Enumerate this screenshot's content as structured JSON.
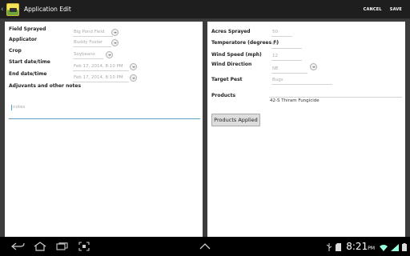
{
  "actionbar": {
    "title": "Application Edit",
    "cancel_label": "CANCEL",
    "save_label": "SAVE"
  },
  "left_panel": {
    "field_sprayed": {
      "label": "Field Sprayed",
      "value": "Big Pond Field"
    },
    "applicator": {
      "label": "Applicator",
      "value": "Buddy Foster"
    },
    "crop": {
      "label": "Crop",
      "value": "Soybeans"
    },
    "start_datetime": {
      "label": "Start date/time",
      "value": "Feb 17, 2014, 8:10 PM"
    },
    "end_datetime": {
      "label": "End date/time",
      "value": "Feb 17, 2014, 8:10 PM"
    },
    "adjuvants": {
      "label": "Adjuvants and other notes",
      "placeholder": "notes"
    }
  },
  "right_panel": {
    "acres_sprayed": {
      "label": "Acres Sprayed",
      "value": "50"
    },
    "temperature": {
      "label": "Temperatore (degrees F)",
      "value": "67"
    },
    "wind_speed": {
      "label": "Wind Speed (mph)",
      "value": "12"
    },
    "wind_direction": {
      "label": "Wind Direction",
      "value": "NE"
    },
    "target_pest": {
      "label": "Target Pest",
      "value": "Bugs"
    },
    "products": {
      "label": "Products",
      "items": [
        "42-S Thiram Fungicide"
      ]
    },
    "products_button": "Products Applied"
  },
  "statusbar": {
    "time": "8:21",
    "ampm": "PM"
  },
  "icons": [
    "back-icon",
    "home-icon",
    "recent-apps-icon",
    "screenshot-icon",
    "menu-up-icon",
    "usb-icon",
    "sd-card-icon",
    "wifi-icon",
    "signal-icon",
    "battery-icon"
  ]
}
